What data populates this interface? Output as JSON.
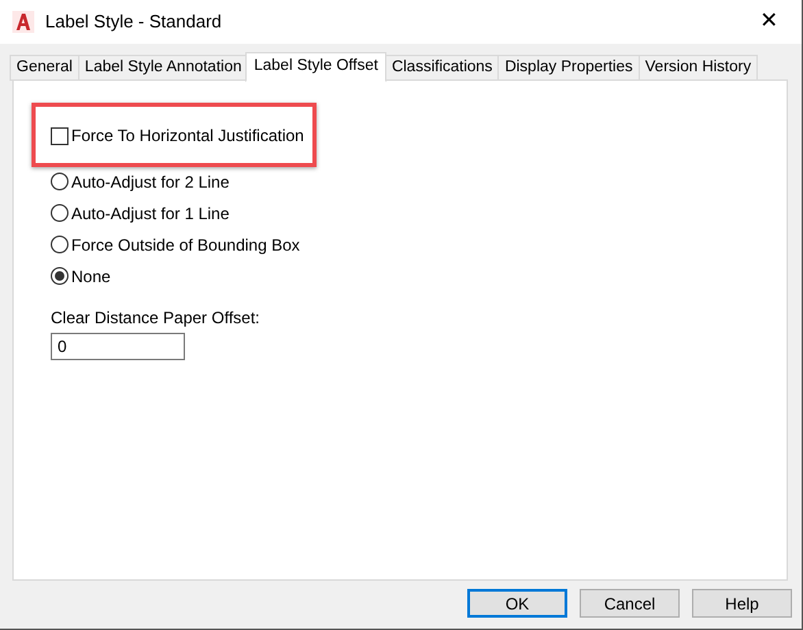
{
  "window": {
    "title": "Label Style - Standard",
    "close": "✕"
  },
  "tabs": [
    {
      "label": "General",
      "selected": false
    },
    {
      "label": "Label Style Annotation",
      "selected": false
    },
    {
      "label": "Label Style Offset",
      "selected": true
    },
    {
      "label": "Classifications",
      "selected": false
    },
    {
      "label": "Display Properties",
      "selected": false
    },
    {
      "label": "Version History",
      "selected": false
    }
  ],
  "checkbox": {
    "label": "Force To Horizontal Justification",
    "checked": false,
    "highlighted": true
  },
  "radios": [
    {
      "label": "Auto-Adjust for 2 Line",
      "selected": false
    },
    {
      "label": "Auto-Adjust for 1 Line",
      "selected": false
    },
    {
      "label": "Force Outside of Bounding Box",
      "selected": false
    },
    {
      "label": "None",
      "selected": true
    }
  ],
  "offset_field": {
    "label": "Clear Distance Paper Offset:",
    "value": "0"
  },
  "buttons": [
    {
      "label": "OK",
      "default": true
    },
    {
      "label": "Cancel",
      "default": false
    },
    {
      "label": "Help",
      "default": false
    }
  ]
}
